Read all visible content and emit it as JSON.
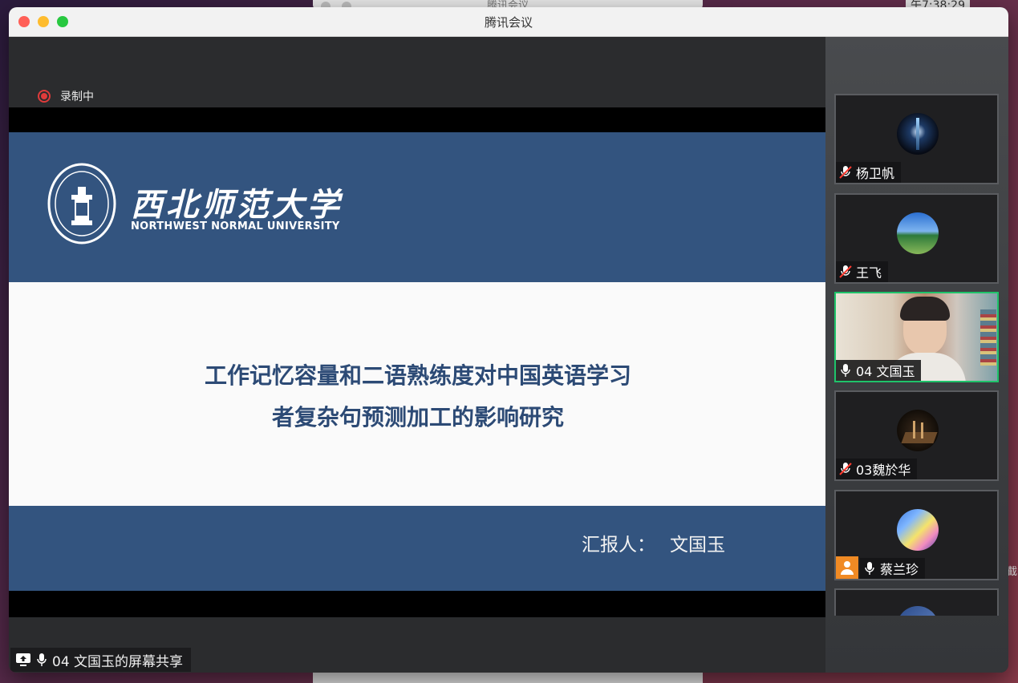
{
  "background": {
    "window_title": "腾讯会议",
    "clock": "午7:38:29",
    "side_text": "截"
  },
  "window": {
    "title": "腾讯会议"
  },
  "recording": {
    "label": "录制中"
  },
  "slide": {
    "university_cn": "西北师范大学",
    "university_en": "NORTHWEST NORMAL UNIVERSITY",
    "title_line1": "工作记忆容量和二语熟练度对中国英语学习",
    "title_line2": "者复杂句预测加工的影响研究",
    "presenter_label": "汇报人：",
    "presenter_name": "文国玉"
  },
  "share_badge": {
    "label": "04 文国玉的屏幕共享"
  },
  "participants": [
    {
      "name": "杨卫帆",
      "mic": "muted",
      "active": false,
      "avatar": "dark-tower"
    },
    {
      "name": "王飞",
      "mic": "muted",
      "active": false,
      "avatar": "landscape"
    },
    {
      "name": "04 文国玉",
      "mic": "on",
      "active": true,
      "avatar": "video"
    },
    {
      "name": "03魏於华",
      "mic": "muted",
      "active": false,
      "avatar": "dark-room"
    },
    {
      "name": "蔡兰珍",
      "mic": "on",
      "active": false,
      "avatar": "rainbow"
    }
  ],
  "colors": {
    "slide_band": "#33547f",
    "slide_title": "#2c4a75",
    "active_border": "#1fc36a",
    "record_red": "#e03b3b"
  }
}
